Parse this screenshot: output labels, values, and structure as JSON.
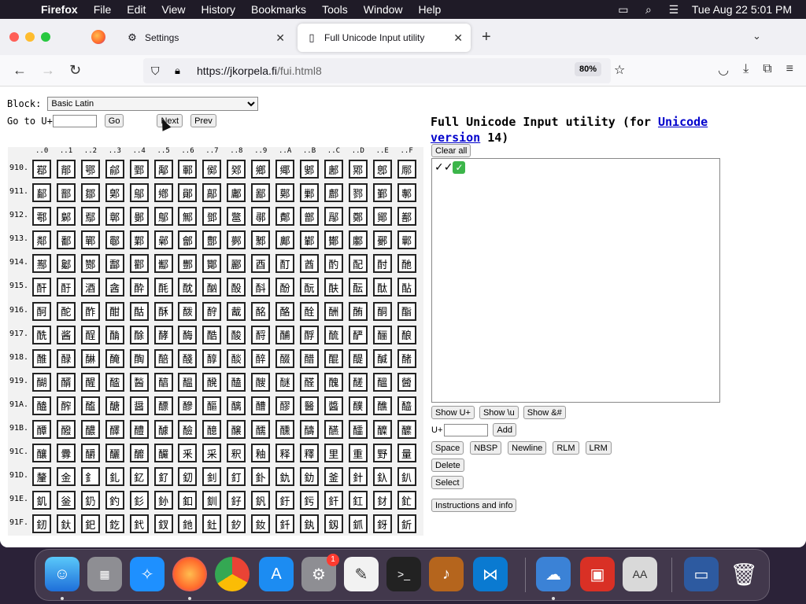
{
  "menubar": {
    "app": "Firefox",
    "items": [
      "File",
      "Edit",
      "View",
      "History",
      "Bookmarks",
      "Tools",
      "Window",
      "Help"
    ],
    "clock": "Tue Aug 22  5:01 PM"
  },
  "tabs": {
    "settings_title": "Settings",
    "active_title": "Full Unicode Input utility"
  },
  "navbar": {
    "url_host": "https://jkorpela.fi",
    "url_path": "/fui.html8",
    "zoom": "80%"
  },
  "page": {
    "block_label": "Block:",
    "block_selected": "Basic Latin",
    "goto_label": "Go to U+",
    "go_label": "Go",
    "next_label": "Next",
    "prev_label": "Prev",
    "col_headers": [
      "..0",
      "..1",
      "..2",
      "..3",
      "..4",
      "..5",
      "..6",
      "..7",
      "..8",
      "..9",
      "..A",
      "..B",
      "..C",
      "..D",
      "..E",
      "..F"
    ],
    "rows": [
      {
        "label": "910.",
        "chars": [
          "鄀",
          "鄁",
          "鄂",
          "鄃",
          "鄄",
          "鄅",
          "鄆",
          "鄇",
          "鄈",
          "鄉",
          "鄊",
          "鄋",
          "鄌",
          "鄍",
          "鄎",
          "鄏"
        ]
      },
      {
        "label": "911.",
        "chars": [
          "鄐",
          "鄑",
          "鄒",
          "鄓",
          "鄔",
          "鄕",
          "鄖",
          "鄗",
          "鄘",
          "鄙",
          "鄚",
          "鄛",
          "鄜",
          "鄝",
          "鄞",
          "鄟"
        ]
      },
      {
        "label": "912.",
        "chars": [
          "鄠",
          "鄡",
          "鄢",
          "鄣",
          "鄤",
          "鄥",
          "鄦",
          "鄧",
          "鄨",
          "鄩",
          "鄪",
          "鄫",
          "鄬",
          "鄭",
          "鄮",
          "鄯"
        ]
      },
      {
        "label": "913.",
        "chars": [
          "鄰",
          "鄱",
          "鄲",
          "鄳",
          "鄴",
          "鄵",
          "鄶",
          "鄷",
          "鄸",
          "鄹",
          "鄺",
          "鄻",
          "鄼",
          "鄽",
          "鄾",
          "鄿"
        ]
      },
      {
        "label": "914.",
        "chars": [
          "酀",
          "酁",
          "酂",
          "酃",
          "酄",
          "酅",
          "酆",
          "酇",
          "酈",
          "酉",
          "酊",
          "酋",
          "酌",
          "配",
          "酎",
          "酏"
        ]
      },
      {
        "label": "915.",
        "chars": [
          "酐",
          "酑",
          "酒",
          "酓",
          "酔",
          "酕",
          "酖",
          "酗",
          "酘",
          "酙",
          "酚",
          "酛",
          "酜",
          "酝",
          "酞",
          "酟"
        ]
      },
      {
        "label": "916.",
        "chars": [
          "酠",
          "酡",
          "酢",
          "酣",
          "酤",
          "酥",
          "酦",
          "酧",
          "酨",
          "酩",
          "酪",
          "酫",
          "酬",
          "酭",
          "酮",
          "酯"
        ]
      },
      {
        "label": "917.",
        "chars": [
          "酰",
          "酱",
          "酲",
          "酳",
          "酴",
          "酵",
          "酶",
          "酷",
          "酸",
          "酹",
          "酺",
          "酻",
          "酼",
          "酽",
          "酾",
          "酿"
        ]
      },
      {
        "label": "918.",
        "chars": [
          "醀",
          "醁",
          "醂",
          "醃",
          "醄",
          "醅",
          "醆",
          "醇",
          "醈",
          "醉",
          "醊",
          "醋",
          "醌",
          "醍",
          "醎",
          "醏"
        ]
      },
      {
        "label": "919.",
        "chars": [
          "醐",
          "醑",
          "醒",
          "醓",
          "醔",
          "醕",
          "醖",
          "醗",
          "醘",
          "醙",
          "醚",
          "醛",
          "醜",
          "醝",
          "醞",
          "醟"
        ]
      },
      {
        "label": "91A.",
        "chars": [
          "醠",
          "醡",
          "醢",
          "醣",
          "醤",
          "醥",
          "醦",
          "醧",
          "醨",
          "醩",
          "醪",
          "醫",
          "醬",
          "醭",
          "醮",
          "醯"
        ]
      },
      {
        "label": "91B.",
        "chars": [
          "醰",
          "醱",
          "醲",
          "醳",
          "醴",
          "醵",
          "醶",
          "醷",
          "醸",
          "醹",
          "醺",
          "醻",
          "醼",
          "醽",
          "醾",
          "醿"
        ]
      },
      {
        "label": "91C.",
        "chars": [
          "釀",
          "釁",
          "釂",
          "釃",
          "釄",
          "釅",
          "釆",
          "采",
          "釈",
          "釉",
          "释",
          "釋",
          "里",
          "重",
          "野",
          "量"
        ]
      },
      {
        "label": "91D.",
        "chars": [
          "釐",
          "金",
          "釒",
          "釓",
          "釔",
          "釕",
          "釖",
          "釗",
          "釘",
          "釙",
          "釚",
          "釛",
          "釜",
          "針",
          "釞",
          "釟"
        ]
      },
      {
        "label": "91E.",
        "chars": [
          "釠",
          "釡",
          "釢",
          "釣",
          "釤",
          "釥",
          "釦",
          "釧",
          "釨",
          "釩",
          "釪",
          "釫",
          "釬",
          "釭",
          "釮",
          "釯"
        ]
      },
      {
        "label": "91F.",
        "chars": [
          "釰",
          "釱",
          "釲",
          "釳",
          "釴",
          "釵",
          "釶",
          "釷",
          "釸",
          "釹",
          "釺",
          "釻",
          "釼",
          "釽",
          "釾",
          "釿"
        ]
      }
    ],
    "title_prefix": "Full Unicode Input utility (for ",
    "title_link1": "Unicode",
    "title_link2": "version",
    "title_suffix": " 14)",
    "clear_all": "Clear all",
    "output_text": "✓✓",
    "output_check": "✓",
    "show_uplus": "Show U+",
    "show_u": "Show \\u",
    "show_amp": "Show &#",
    "uplus_label": "U+",
    "add_label": "Add",
    "space": "Space",
    "nbsp": "NBSP",
    "newline": "Newline",
    "rlm": "RLM",
    "lrm": "LRM",
    "delete": "Delete",
    "select": "Select",
    "instructions": "Instructions and info"
  },
  "dock": {
    "settings_badge": "1"
  }
}
